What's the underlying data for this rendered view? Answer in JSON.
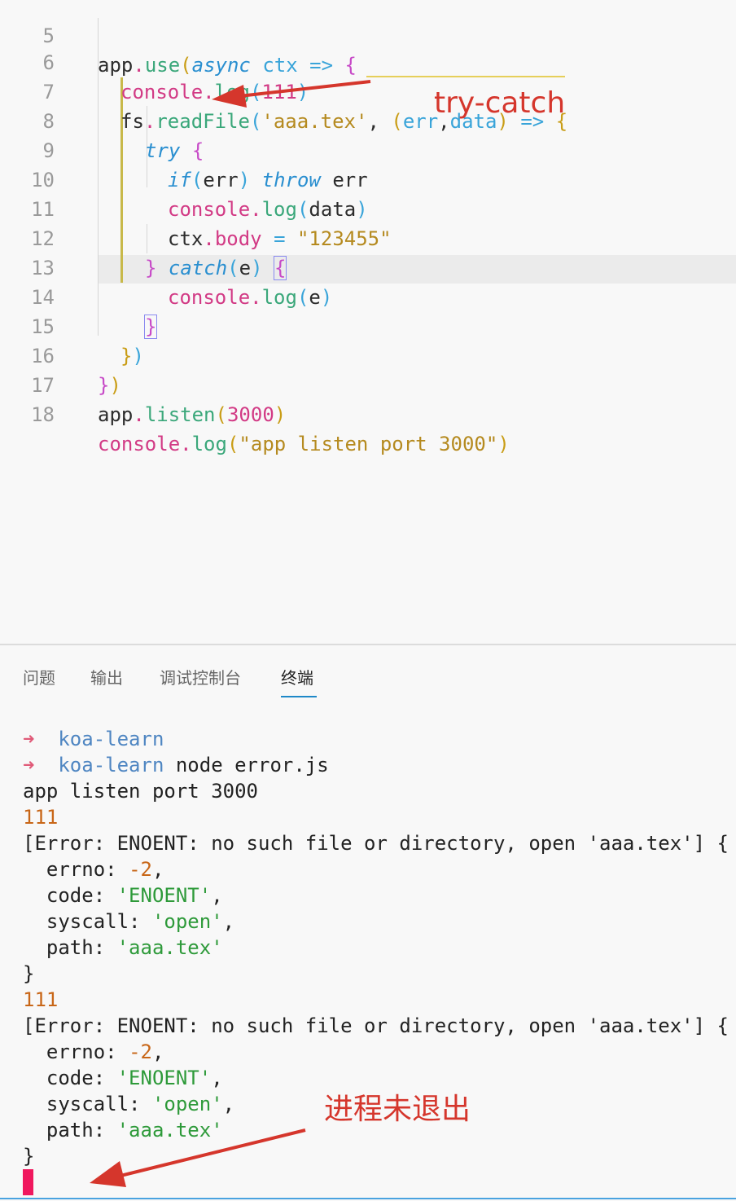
{
  "editor": {
    "line_numbers": [
      "5",
      "6",
      "7",
      "8",
      "9",
      "10",
      "11",
      "12",
      "13",
      "14",
      "15",
      "16",
      "17",
      "18"
    ]
  },
  "annotations": {
    "try_catch": "try-catch",
    "process_not_exit": "进程未退出"
  },
  "panel": {
    "tabs": [
      "问题",
      "输出",
      "调试控制台",
      "终端"
    ],
    "active_tab": "终端",
    "terminal": {
      "dir": "koa-learn",
      "command": "node error.js",
      "listen_line": "app listen port 3000",
      "count_line": "111",
      "error_header": "[Error: ENOENT: no such file or directory, open 'aaa.tex'] {",
      "errno_key": "errno: ",
      "errno_val": "-2",
      "code_key": "code: ",
      "code_val": "'ENOENT'",
      "syscall_key": "syscall: ",
      "syscall_val": "'open'",
      "path_key": "path: ",
      "path_val": "'aaa.tex'",
      "close_brace": "}"
    }
  },
  "colors": {
    "keyword": "#d23a85",
    "function": "#3aa77a",
    "string": "#b58a1f",
    "number": "#c86617",
    "annotation": "#d5362c",
    "cursor": "#f0185e",
    "tab_underline": "#1e88c8"
  }
}
